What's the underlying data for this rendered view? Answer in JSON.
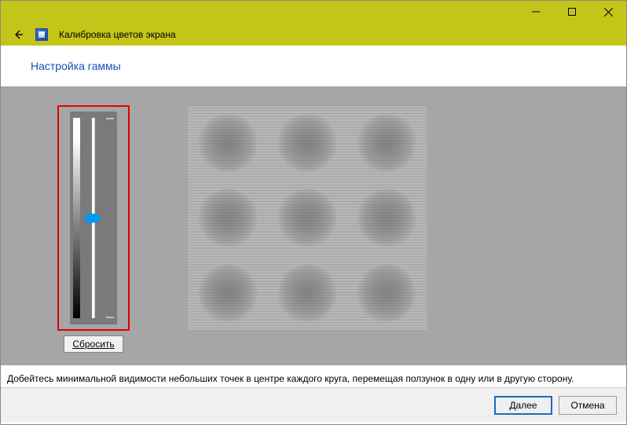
{
  "window": {
    "title": "Калибровка цветов экрана"
  },
  "page": {
    "heading": "Настройка гаммы"
  },
  "slider": {
    "reset_label": "Сбросить"
  },
  "instruction": {
    "text": "Добейтесь минимальной видимости небольших точек в центре каждого круга, перемещая ползунок в одну или в другую сторону."
  },
  "footer": {
    "next_label": "Далее",
    "cancel_label": "Отмена"
  }
}
